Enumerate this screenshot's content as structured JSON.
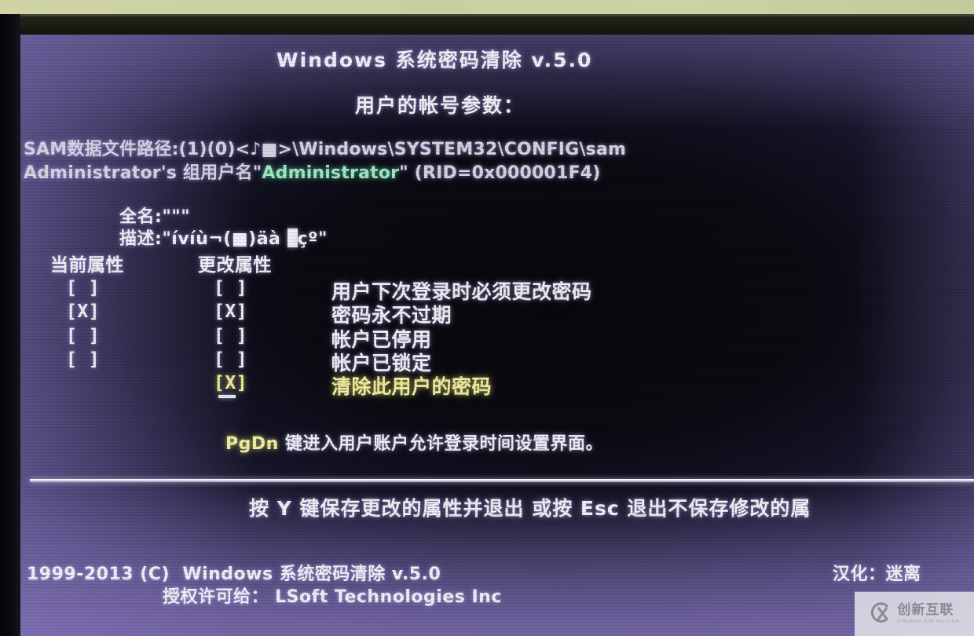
{
  "app": {
    "title": "Windows 系统密码清除 v.5.0",
    "subtitle": "用户的帐号参数："
  },
  "account": {
    "sam_label": "SAM数据文件路径:(1)(0)<♪■>\\Windows\\SYSTEM32\\CONFIG\\sam",
    "group_prefix": "Administrator's 组用户名\"",
    "username": "Administrator",
    "group_suffix": "\" (RID=0x000001F4)",
    "fullname_label": "全名:",
    "fullname_value": "\"\"\"",
    "description_label": "描述:",
    "description_value_pre": "\"ívíù¬(■)äà ",
    "description_value_post": "çº\""
  },
  "attributes": {
    "col_current_header": "当前属性",
    "col_change_header": "更改属性",
    "rows": [
      {
        "current": "[ ]",
        "change": "[ ]",
        "label": "用户下次登录时必须更改密码",
        "highlight": false
      },
      {
        "current": "[X]",
        "change": "[X]",
        "label": "密码永不过期",
        "highlight": false
      },
      {
        "current": "[ ]",
        "change": "[ ]",
        "label": "帐户已停用",
        "highlight": false
      },
      {
        "current": "[ ]",
        "change": "[ ]",
        "label": "帐户已锁定",
        "highlight": false
      },
      {
        "current": "",
        "change": "[X]",
        "label": "清除此用户的密码",
        "highlight": true
      }
    ]
  },
  "hints": {
    "pgdn_key": "PgDn",
    "pgdn_text": "键进入用户账户允许登录时间设置界面。",
    "bottom_instruction": "按 Y 键保存更改的属性并退出 或按 Esc 退出不保存修改的属"
  },
  "footer": {
    "copyright": "1999-2013 (C)  Windows 系统密码清除 v.5.0",
    "license": "授权许可给： LSoft Technologies Inc",
    "translator": "汉化：迷离"
  },
  "watermark": {
    "cn": "创新互联",
    "en": "CHUANG XIN HU LIAN",
    "logo": "cx-logo-icon"
  },
  "colors": {
    "text": "#f0f0f5",
    "accent_green": "#9fe9c4",
    "accent_yellow": "#f2f0a0",
    "screen_purple": "#6a5f9b"
  }
}
